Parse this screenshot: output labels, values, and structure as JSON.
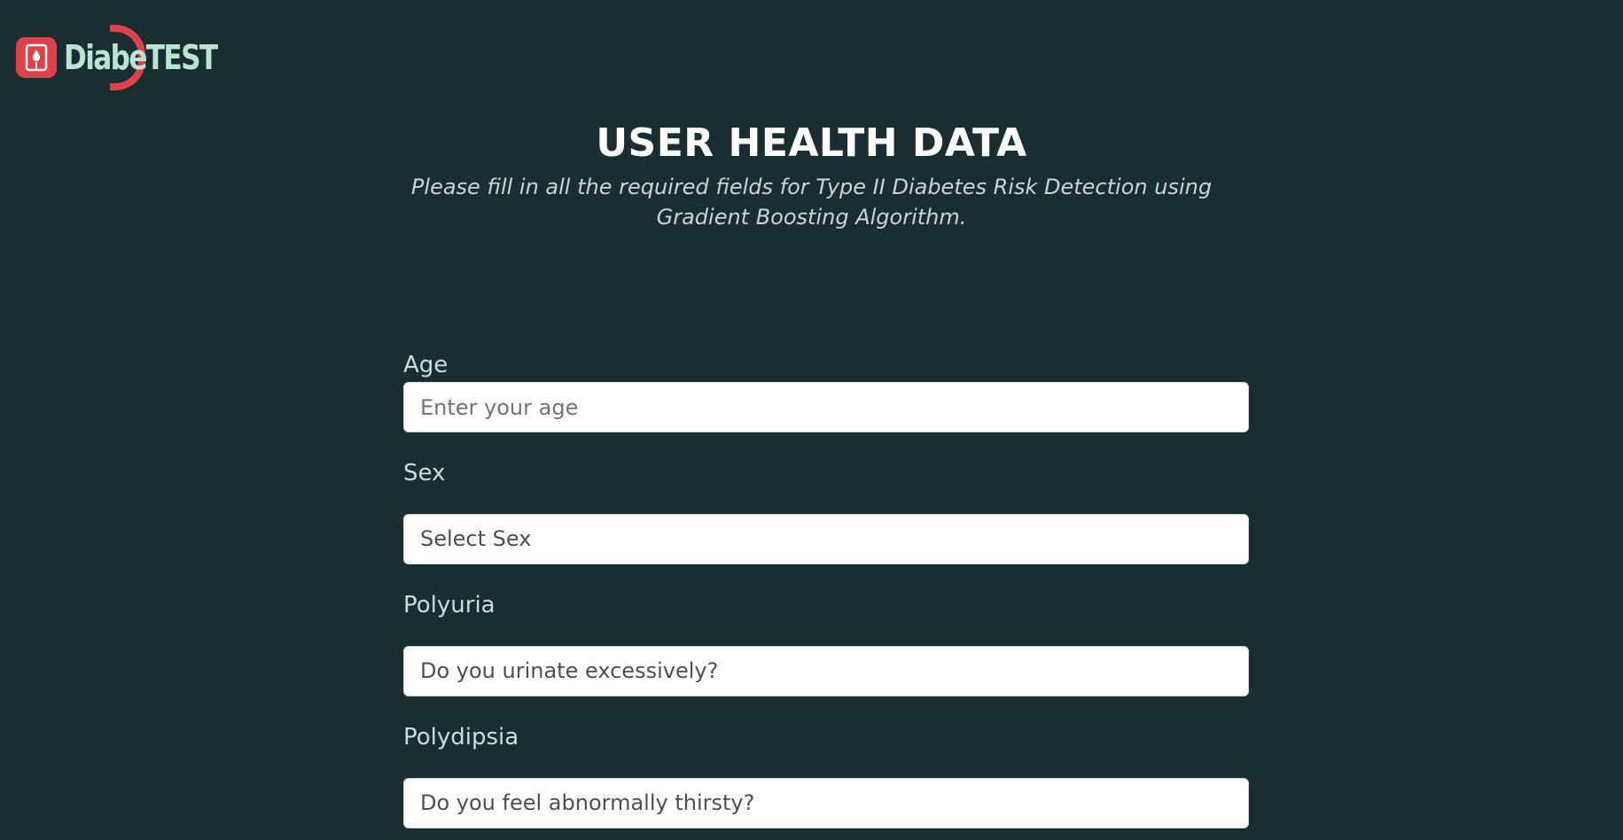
{
  "brand": {
    "name": "DiabeTEST",
    "icon": "glucometer-icon",
    "accent": "#e0404a",
    "text_color": "#b9e3d2"
  },
  "header": {
    "title": "USER HEALTH DATA",
    "subtitle": "Please fill in all the required fields for Type II Diabetes Risk Detection using Gradient Boosting Algorithm."
  },
  "form": {
    "age": {
      "label": "Age",
      "placeholder": "Enter your age",
      "value": ""
    },
    "sex": {
      "label": "Sex",
      "selected": "Select Sex"
    },
    "polyuria": {
      "label": "Polyuria",
      "selected": "Do you urinate excessively?"
    },
    "polydipsia": {
      "label": "Polydipsia",
      "selected": "Do you feel abnormally thirsty?"
    }
  },
  "colors": {
    "background": "#1a2e32",
    "title": "#ffffff",
    "label": "#c7dedc"
  }
}
